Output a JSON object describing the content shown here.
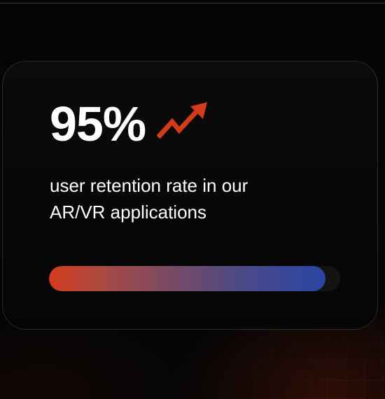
{
  "stat": {
    "value": "95%",
    "description_line1": "user retention rate in our",
    "description_line2": "AR/VR applications",
    "trend_icon": "trending-up-arrow-icon"
  },
  "progress": {
    "fraction": 0.95
  },
  "colors": {
    "background": "#050505",
    "card_background": "#0b0b0b",
    "text": "#ffffff",
    "accent_red": "#d23b1c",
    "accent_blue": "#2b44a6"
  }
}
